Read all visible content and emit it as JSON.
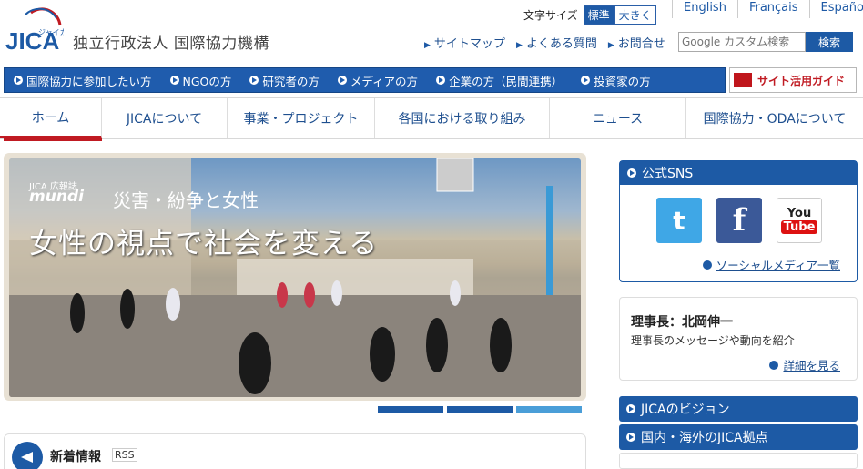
{
  "header": {
    "org_name": "独立行政法人 国際協力機構",
    "logo_text": "JICA",
    "logo_sub": "ジャイカ",
    "font_size_label": "文字サイズ",
    "font_standard": "標準",
    "font_large": "大きく",
    "languages": [
      "English",
      "Français",
      "Español"
    ],
    "utility_links": [
      "サイトマップ",
      "よくある質問",
      "お問合せ"
    ],
    "search_placeholder": "Google カスタム検索",
    "search_button": "検索"
  },
  "audience_nav": [
    "国際協力に参加したい方",
    "NGOの方",
    "研究者の方",
    "メディアの方",
    "企業の方（民間連携）",
    "投資家の方"
  ],
  "site_guide": "サイト活用ガイド",
  "global_nav": [
    "ホーム",
    "JICAについて",
    "事業・プロジェクト",
    "各国における取り組み",
    "ニュース",
    "国際協力・ODAについて"
  ],
  "hero": {
    "magazine": "JICA 広報誌",
    "mundi": "mundi",
    "theme": "災害・紛争と女性",
    "headline": "女性の視点で社会を変える",
    "slides": 3,
    "active_slide": 3
  },
  "news": {
    "title": "新着情報",
    "rss": "RSS"
  },
  "sidebar": {
    "sns_title": "公式SNS",
    "twitter": "t",
    "facebook": "f",
    "youtube_you": "You",
    "youtube_tube": "Tube",
    "sns_more": "ソーシャルメディア一覧",
    "president_name": "理事長：北岡伸一",
    "president_desc": "理事長のメッセージや動向を紹介",
    "president_more": "詳細を見る",
    "vision": "JICAのビジョン",
    "offices": "国内・海外のJICA拠点"
  },
  "colors": {
    "primary": "#1d5aa5",
    "accent_red": "#c01a22"
  }
}
